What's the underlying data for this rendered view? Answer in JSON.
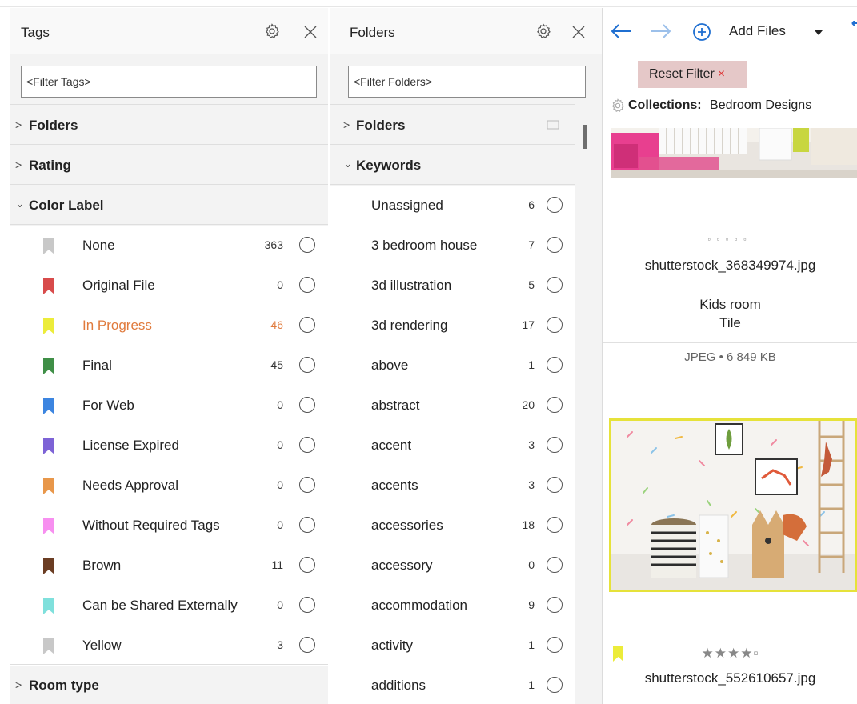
{
  "tags_pane": {
    "title": "Tags",
    "filter_placeholder": "<Filter Tags>",
    "sections": {
      "folders": "Folders",
      "rating": "Rating",
      "color_label": "Color Label",
      "room_type": "Room type"
    },
    "color_labels": [
      {
        "label": "None",
        "count": "363",
        "color": "#c8c8c8"
      },
      {
        "label": "Original File",
        "count": "0",
        "color": "#d84b4b"
      },
      {
        "label": "In Progress",
        "count": "46",
        "color": "#ecec3a",
        "highlight": "#e07a3c"
      },
      {
        "label": "Final",
        "count": "45",
        "color": "#3f8f47"
      },
      {
        "label": "For Web",
        "count": "0",
        "color": "#3c85e0"
      },
      {
        "label": "License Expired",
        "count": "0",
        "color": "#7d63d6"
      },
      {
        "label": "Needs Approval",
        "count": "0",
        "color": "#e8974a"
      },
      {
        "label": "Without Required Tags",
        "count": "0",
        "color": "#f78ff0"
      },
      {
        "label": "Brown",
        "count": "11",
        "color": "#6b3d23"
      },
      {
        "label": "Can be Shared Externally",
        "count": "0",
        "color": "#7fe0dc"
      },
      {
        "label": "Yellow",
        "count": "3",
        "color": "#c8c8c8"
      }
    ]
  },
  "folders_pane": {
    "title": "Folders",
    "filter_placeholder": "<Filter Folders>",
    "sections": {
      "folders": "Folders",
      "keywords": "Keywords"
    },
    "keywords": [
      {
        "label": "Unassigned",
        "count": "6"
      },
      {
        "label": "3 bedroom house",
        "count": "7"
      },
      {
        "label": "3d illustration",
        "count": "5"
      },
      {
        "label": "3d rendering",
        "count": "17"
      },
      {
        "label": "above",
        "count": "1"
      },
      {
        "label": "abstract",
        "count": "20"
      },
      {
        "label": "accent",
        "count": "3"
      },
      {
        "label": "accents",
        "count": "3"
      },
      {
        "label": "accessories",
        "count": "18"
      },
      {
        "label": "accessory",
        "count": "0"
      },
      {
        "label": "accommodation",
        "count": "9"
      },
      {
        "label": "activity",
        "count": "1"
      },
      {
        "label": "additions",
        "count": "1"
      }
    ]
  },
  "files_pane": {
    "toolbar": {
      "add_files_label": "Add Files"
    },
    "reset_filter_label": "Reset Filter",
    "reset_filter_x": "×",
    "collections_label": "Collections:",
    "collections_value": "Bedroom Designs",
    "file1": {
      "name": "shutterstock_368349974.jpg",
      "tag1": "Kids room",
      "tag2": "Tile",
      "format_line": "JPEG • 6 849 KB",
      "dots": "▫▫▫▫▫"
    },
    "file2": {
      "name": "shutterstock_552610657.jpg",
      "stars": "★★★★▫",
      "color": "#ecec3a"
    }
  },
  "colors": {
    "accent_blue": "#1f6fd1",
    "pane_bg": "#f3f3f3",
    "highlight_orange": "#e07a3c"
  }
}
